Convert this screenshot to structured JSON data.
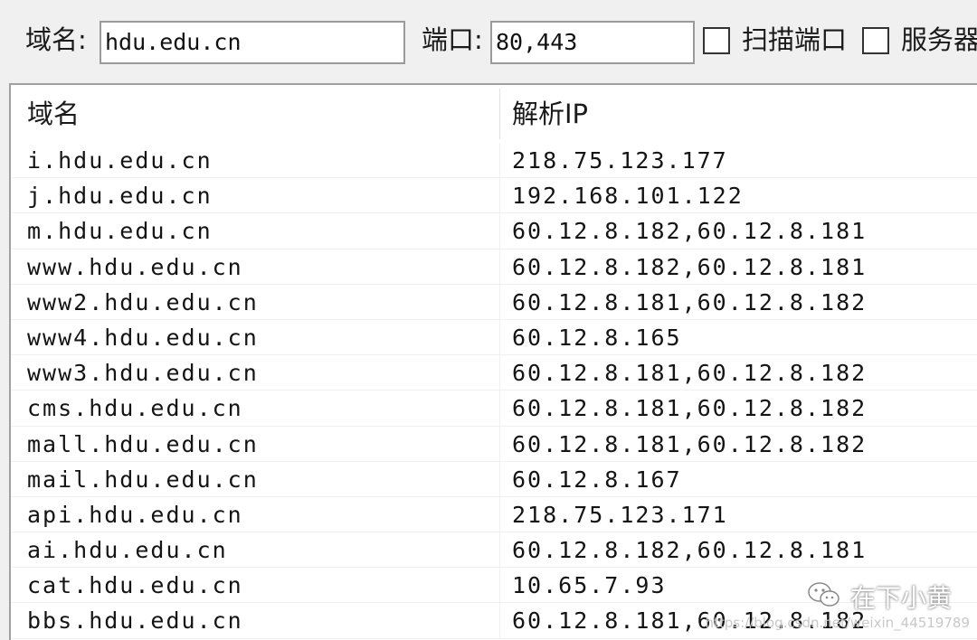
{
  "toolbar": {
    "domain_label": "域名:",
    "domain_value": "hdu.edu.cn",
    "port_label": "端口:",
    "port_value": "80,443",
    "scan_port_label": "扫描端口",
    "service_label": "服务器"
  },
  "table": {
    "columns": [
      "域名",
      "解析IP"
    ],
    "rows": [
      {
        "domain": "i.hdu.edu.cn",
        "ip": "218.75.123.177"
      },
      {
        "domain": "j.hdu.edu.cn",
        "ip": "192.168.101.122"
      },
      {
        "domain": "m.hdu.edu.cn",
        "ip": "60.12.8.182,60.12.8.181"
      },
      {
        "domain": "www.hdu.edu.cn",
        "ip": "60.12.8.182,60.12.8.181"
      },
      {
        "domain": "www2.hdu.edu.cn",
        "ip": "60.12.8.181,60.12.8.182"
      },
      {
        "domain": "www4.hdu.edu.cn",
        "ip": "60.12.8.165"
      },
      {
        "domain": "www3.hdu.edu.cn",
        "ip": "60.12.8.181,60.12.8.182"
      },
      {
        "domain": "cms.hdu.edu.cn",
        "ip": "60.12.8.181,60.12.8.182"
      },
      {
        "domain": "mall.hdu.edu.cn",
        "ip": "60.12.8.181,60.12.8.182"
      },
      {
        "domain": "mail.hdu.edu.cn",
        "ip": "60.12.8.167"
      },
      {
        "domain": "api.hdu.edu.cn",
        "ip": "218.75.123.171"
      },
      {
        "domain": "ai.hdu.edu.cn",
        "ip": "60.12.8.182,60.12.8.181"
      },
      {
        "domain": "cat.hdu.edu.cn",
        "ip": "10.65.7.93"
      },
      {
        "domain": "bbs.hdu.edu.cn",
        "ip": "60.12.8.181,60.12.8.182"
      }
    ]
  },
  "watermark": {
    "text": "在下小黄",
    "icon": "wechat-icon",
    "url": "https://blog.csdn.net/weixin_44519789"
  }
}
